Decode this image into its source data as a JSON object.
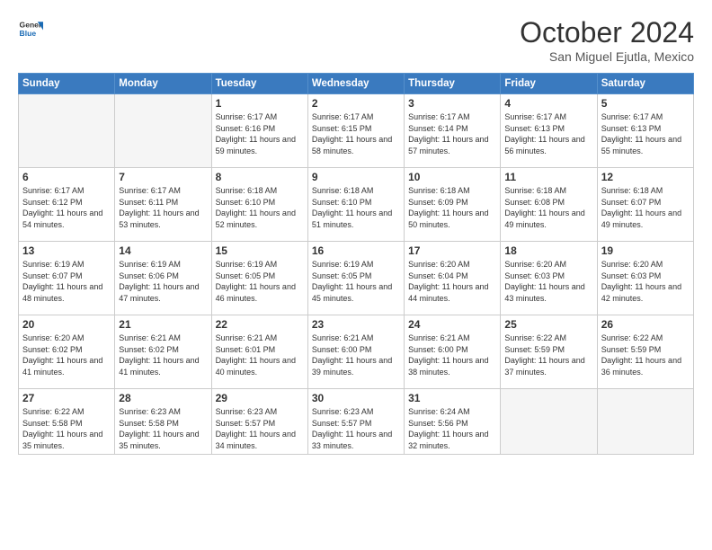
{
  "logo": {
    "line1": "General",
    "line2": "Blue"
  },
  "header": {
    "month": "October 2024",
    "location": "San Miguel Ejutla, Mexico"
  },
  "weekdays": [
    "Sunday",
    "Monday",
    "Tuesday",
    "Wednesday",
    "Thursday",
    "Friday",
    "Saturday"
  ],
  "weeks": [
    [
      {
        "day": "",
        "empty": true
      },
      {
        "day": "",
        "empty": true
      },
      {
        "day": "1",
        "sunrise": "6:17 AM",
        "sunset": "6:16 PM",
        "daylight": "11 hours and 59 minutes."
      },
      {
        "day": "2",
        "sunrise": "6:17 AM",
        "sunset": "6:15 PM",
        "daylight": "11 hours and 58 minutes."
      },
      {
        "day": "3",
        "sunrise": "6:17 AM",
        "sunset": "6:14 PM",
        "daylight": "11 hours and 57 minutes."
      },
      {
        "day": "4",
        "sunrise": "6:17 AM",
        "sunset": "6:13 PM",
        "daylight": "11 hours and 56 minutes."
      },
      {
        "day": "5",
        "sunrise": "6:17 AM",
        "sunset": "6:13 PM",
        "daylight": "11 hours and 55 minutes."
      }
    ],
    [
      {
        "day": "6",
        "sunrise": "6:17 AM",
        "sunset": "6:12 PM",
        "daylight": "11 hours and 54 minutes."
      },
      {
        "day": "7",
        "sunrise": "6:17 AM",
        "sunset": "6:11 PM",
        "daylight": "11 hours and 53 minutes."
      },
      {
        "day": "8",
        "sunrise": "6:18 AM",
        "sunset": "6:10 PM",
        "daylight": "11 hours and 52 minutes."
      },
      {
        "day": "9",
        "sunrise": "6:18 AM",
        "sunset": "6:10 PM",
        "daylight": "11 hours and 51 minutes."
      },
      {
        "day": "10",
        "sunrise": "6:18 AM",
        "sunset": "6:09 PM",
        "daylight": "11 hours and 50 minutes."
      },
      {
        "day": "11",
        "sunrise": "6:18 AM",
        "sunset": "6:08 PM",
        "daylight": "11 hours and 49 minutes."
      },
      {
        "day": "12",
        "sunrise": "6:18 AM",
        "sunset": "6:07 PM",
        "daylight": "11 hours and 49 minutes."
      }
    ],
    [
      {
        "day": "13",
        "sunrise": "6:19 AM",
        "sunset": "6:07 PM",
        "daylight": "11 hours and 48 minutes."
      },
      {
        "day": "14",
        "sunrise": "6:19 AM",
        "sunset": "6:06 PM",
        "daylight": "11 hours and 47 minutes."
      },
      {
        "day": "15",
        "sunrise": "6:19 AM",
        "sunset": "6:05 PM",
        "daylight": "11 hours and 46 minutes."
      },
      {
        "day": "16",
        "sunrise": "6:19 AM",
        "sunset": "6:05 PM",
        "daylight": "11 hours and 45 minutes."
      },
      {
        "day": "17",
        "sunrise": "6:20 AM",
        "sunset": "6:04 PM",
        "daylight": "11 hours and 44 minutes."
      },
      {
        "day": "18",
        "sunrise": "6:20 AM",
        "sunset": "6:03 PM",
        "daylight": "11 hours and 43 minutes."
      },
      {
        "day": "19",
        "sunrise": "6:20 AM",
        "sunset": "6:03 PM",
        "daylight": "11 hours and 42 minutes."
      }
    ],
    [
      {
        "day": "20",
        "sunrise": "6:20 AM",
        "sunset": "6:02 PM",
        "daylight": "11 hours and 41 minutes."
      },
      {
        "day": "21",
        "sunrise": "6:21 AM",
        "sunset": "6:02 PM",
        "daylight": "11 hours and 41 minutes."
      },
      {
        "day": "22",
        "sunrise": "6:21 AM",
        "sunset": "6:01 PM",
        "daylight": "11 hours and 40 minutes."
      },
      {
        "day": "23",
        "sunrise": "6:21 AM",
        "sunset": "6:00 PM",
        "daylight": "11 hours and 39 minutes."
      },
      {
        "day": "24",
        "sunrise": "6:21 AM",
        "sunset": "6:00 PM",
        "daylight": "11 hours and 38 minutes."
      },
      {
        "day": "25",
        "sunrise": "6:22 AM",
        "sunset": "5:59 PM",
        "daylight": "11 hours and 37 minutes."
      },
      {
        "day": "26",
        "sunrise": "6:22 AM",
        "sunset": "5:59 PM",
        "daylight": "11 hours and 36 minutes."
      }
    ],
    [
      {
        "day": "27",
        "sunrise": "6:22 AM",
        "sunset": "5:58 PM",
        "daylight": "11 hours and 35 minutes."
      },
      {
        "day": "28",
        "sunrise": "6:23 AM",
        "sunset": "5:58 PM",
        "daylight": "11 hours and 35 minutes."
      },
      {
        "day": "29",
        "sunrise": "6:23 AM",
        "sunset": "5:57 PM",
        "daylight": "11 hours and 34 minutes."
      },
      {
        "day": "30",
        "sunrise": "6:23 AM",
        "sunset": "5:57 PM",
        "daylight": "11 hours and 33 minutes."
      },
      {
        "day": "31",
        "sunrise": "6:24 AM",
        "sunset": "5:56 PM",
        "daylight": "11 hours and 32 minutes."
      },
      {
        "day": "",
        "empty": true
      },
      {
        "day": "",
        "empty": true
      }
    ]
  ],
  "labels": {
    "sunrise": "Sunrise:",
    "sunset": "Sunset:",
    "daylight": "Daylight:"
  }
}
